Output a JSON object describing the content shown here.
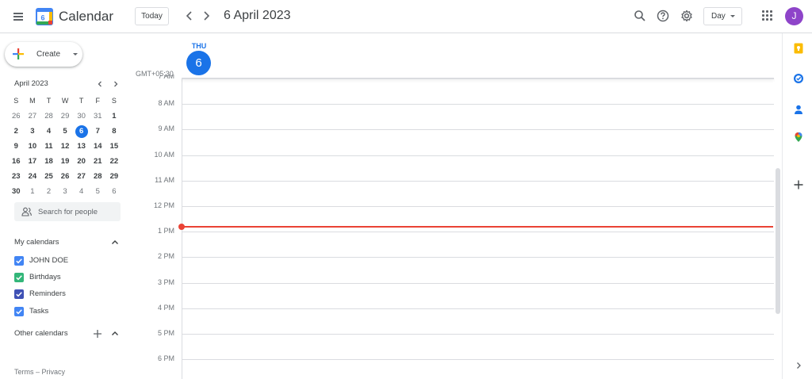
{
  "app": {
    "title": "Calendar",
    "logo_day": "6",
    "user_initial": "J",
    "user_color": "#8e44c9",
    "accent": "#1a73e8",
    "now_color": "#ea4335"
  },
  "header": {
    "today_label": "Today",
    "current_date": "6 April 2023",
    "view_label": "Day",
    "icons": [
      "menu-icon",
      "chevron-left-icon",
      "chevron-right-icon",
      "search-icon",
      "help-icon",
      "settings-icon",
      "apps-icon"
    ]
  },
  "sidebar": {
    "create_label": "Create",
    "mini_calendar": {
      "month_label": "April 2023",
      "weekdays": [
        "S",
        "M",
        "T",
        "W",
        "T",
        "F",
        "S"
      ],
      "days": [
        {
          "d": "26",
          "muted": true
        },
        {
          "d": "27",
          "muted": true
        },
        {
          "d": "28",
          "muted": true
        },
        {
          "d": "29",
          "muted": true
        },
        {
          "d": "30",
          "muted": true
        },
        {
          "d": "31",
          "muted": true
        },
        {
          "d": "1"
        },
        {
          "d": "2"
        },
        {
          "d": "3"
        },
        {
          "d": "4"
        },
        {
          "d": "5"
        },
        {
          "d": "6",
          "selected": true
        },
        {
          "d": "7"
        },
        {
          "d": "8"
        },
        {
          "d": "9"
        },
        {
          "d": "10"
        },
        {
          "d": "11"
        },
        {
          "d": "12"
        },
        {
          "d": "13"
        },
        {
          "d": "14"
        },
        {
          "d": "15"
        },
        {
          "d": "16"
        },
        {
          "d": "17"
        },
        {
          "d": "18"
        },
        {
          "d": "19"
        },
        {
          "d": "20"
        },
        {
          "d": "21"
        },
        {
          "d": "22"
        },
        {
          "d": "23"
        },
        {
          "d": "24"
        },
        {
          "d": "25"
        },
        {
          "d": "26"
        },
        {
          "d": "27"
        },
        {
          "d": "28"
        },
        {
          "d": "29"
        },
        {
          "d": "30"
        },
        {
          "d": "1",
          "muted": true
        },
        {
          "d": "2",
          "muted": true
        },
        {
          "d": "3",
          "muted": true
        },
        {
          "d": "4",
          "muted": true
        },
        {
          "d": "5",
          "muted": true
        },
        {
          "d": "6",
          "muted": true
        }
      ]
    },
    "search_people_placeholder": "Search for people",
    "my_calendars_title": "My calendars",
    "my_calendars": [
      {
        "name": "JOHN DOE",
        "color": "#4285f4",
        "checked": true
      },
      {
        "name": "Birthdays",
        "color": "#33b679",
        "checked": true
      },
      {
        "name": "Reminders",
        "color": "#3f51b5",
        "checked": true
      },
      {
        "name": "Tasks",
        "color": "#4285f4",
        "checked": true
      }
    ],
    "other_calendars_title": "Other calendars",
    "footer": {
      "terms": "Terms",
      "separator": " – ",
      "privacy": "Privacy"
    }
  },
  "day_view": {
    "weekday": "THU",
    "day_number": "6",
    "timezone": "GMT+05:30",
    "hours": [
      "7 AM",
      "8 AM",
      "9 AM",
      "10 AM",
      "11 AM",
      "12 PM",
      "1 PM",
      "2 PM",
      "3 PM",
      "4 PM",
      "5 PM",
      "6 PM"
    ]
  },
  "side_panel": {
    "icons": [
      {
        "name": "keep-icon",
        "color": "#fbbc04"
      },
      {
        "name": "tasks-icon",
        "color": "#1a73e8"
      },
      {
        "name": "contacts-icon",
        "color": "#1a73e8"
      },
      {
        "name": "maps-icon",
        "color": "#34a853"
      }
    ]
  }
}
